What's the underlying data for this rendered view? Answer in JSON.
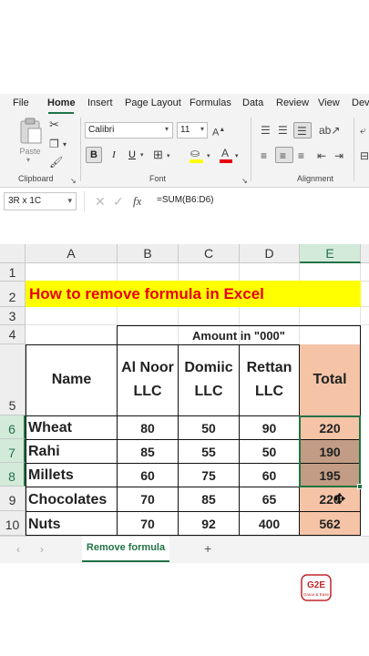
{
  "menu": {
    "tabs": [
      "File",
      "Home",
      "Insert",
      "Page Layout",
      "Formulas",
      "Data",
      "Review",
      "View",
      "Dev"
    ],
    "active": "Home"
  },
  "ribbon": {
    "paste_label": "Paste",
    "font_name": "Calibri",
    "font_size": "11",
    "bold_label": "B",
    "italic_label": "I",
    "underline_label": "U",
    "groups": {
      "clipboard": "Clipboard",
      "font": "Font",
      "alignment": "Alignment"
    }
  },
  "formula_bar": {
    "name_box": "3R x 1C",
    "fx_label": "fx",
    "formula": "=SUM(B6:D6)"
  },
  "grid": {
    "columns": [
      "A",
      "B",
      "C",
      "D",
      "E"
    ],
    "rows": [
      "1",
      "2",
      "3",
      "4",
      "5",
      "6",
      "7",
      "8",
      "9",
      "10"
    ],
    "title": "How to remove formula in Excel",
    "amount_header": "Amount in \"000\"",
    "name_header": "Name",
    "col_headers": [
      {
        "line1": "Al Noor",
        "line2": "LLC"
      },
      {
        "line1": "Domiic",
        "line2": "LLC"
      },
      {
        "line1": "Rettan",
        "line2": "LLC"
      }
    ],
    "total_header": "Total",
    "data_rows": [
      {
        "name": "Wheat",
        "b": "80",
        "c": "50",
        "d": "90",
        "total": "220"
      },
      {
        "name": "Rahi",
        "b": "85",
        "c": "55",
        "d": "50",
        "total": "190"
      },
      {
        "name": "Millets",
        "b": "60",
        "c": "75",
        "d": "60",
        "total": "195"
      },
      {
        "name": "Chocolates",
        "b": "70",
        "c": "85",
        "d": "65",
        "total": "220"
      },
      {
        "name": "Nuts",
        "b": "70",
        "c": "92",
        "d": "400",
        "total": "562"
      }
    ]
  },
  "sheets": {
    "active_tab": "Remove formula",
    "add_label": "+"
  },
  "logo": {
    "text": "G2E",
    "subtext": "Grace & Ease"
  },
  "colors": {
    "accent": "#217346",
    "title_bg": "#ffff00",
    "title_text": "#e8000b",
    "total_bg": "#f5c4a7",
    "selected_total_bg": "#c29c84"
  }
}
